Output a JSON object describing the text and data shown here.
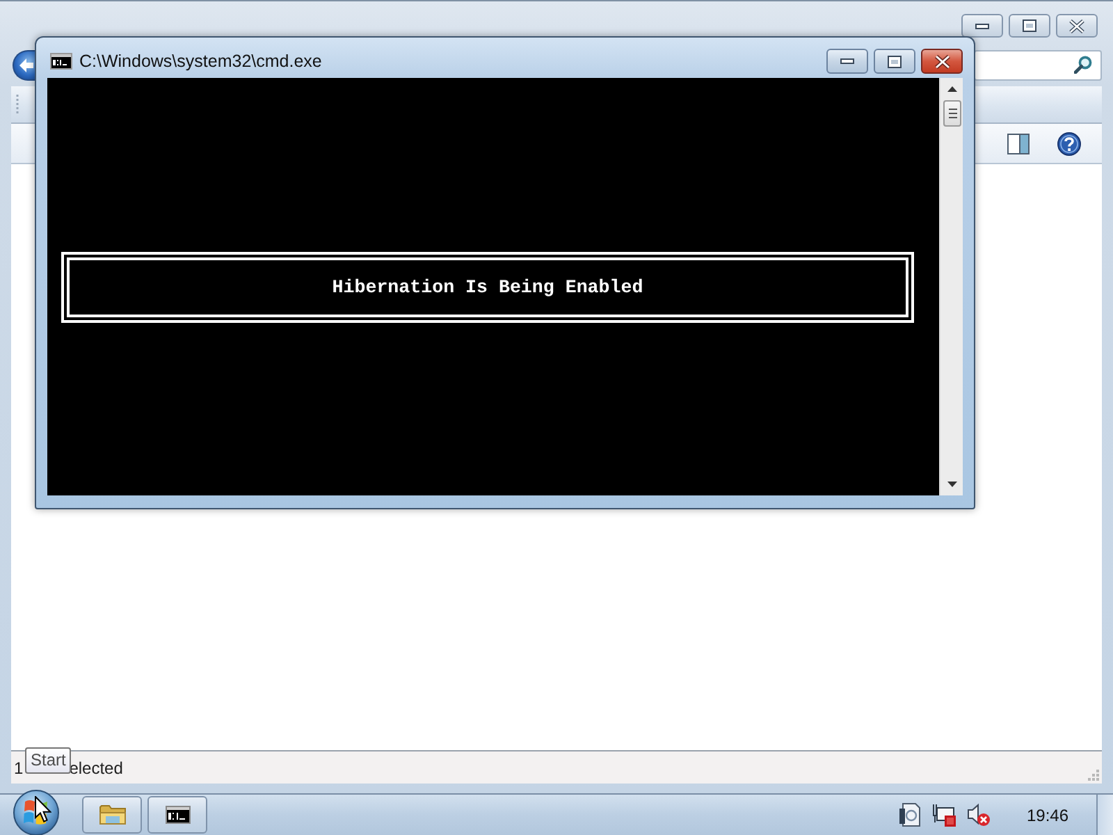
{
  "explorer": {
    "status_bar": {
      "visible_text_parts": [
        "1",
        "elected"
      ]
    }
  },
  "console": {
    "title": "C:\\Windows\\system32\\cmd.exe",
    "banner": "Hibernation Is Being Enabled"
  },
  "tooltip": {
    "text": "Start"
  },
  "taskbar": {
    "buttons": [
      {
        "kind": "folder"
      },
      {
        "kind": "console"
      }
    ],
    "tray_icons": [
      {
        "kind": "document"
      },
      {
        "kind": "network"
      },
      {
        "kind": "volume"
      }
    ],
    "clock": "19:46"
  }
}
